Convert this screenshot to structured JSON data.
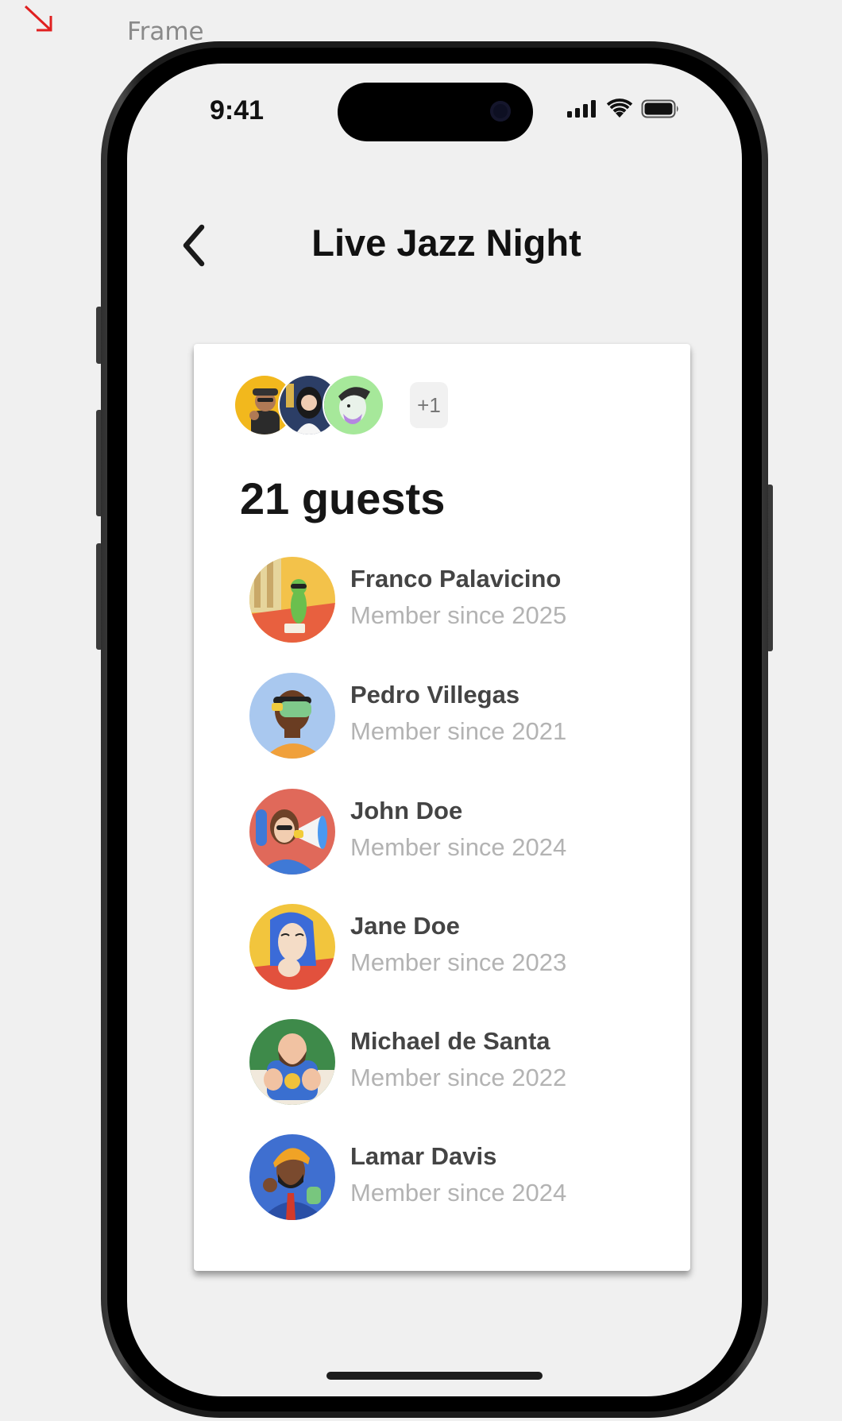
{
  "canvas": {
    "frame_label": "Frame"
  },
  "status_bar": {
    "time": "9:41"
  },
  "header": {
    "title": "Live Jazz Night"
  },
  "card": {
    "more_count": "+1",
    "guest_count": "21 guests",
    "stack_avatars": [
      {
        "icon": "man-with-cap-avatar"
      },
      {
        "icon": "woman-portrait-avatar"
      },
      {
        "icon": "green-character-avatar"
      }
    ],
    "guests": [
      {
        "name": "Franco Palavicino",
        "since": "Member since 2025",
        "icon": "worm-character-avatar"
      },
      {
        "name": "Pedro Villegas",
        "since": "Member since 2021",
        "icon": "vr-headset-man-avatar"
      },
      {
        "name": "John Doe",
        "since": "Member since 2024",
        "icon": "megaphone-woman-avatar"
      },
      {
        "name": "Jane Doe",
        "since": "Member since 2023",
        "icon": "blue-hair-woman-avatar"
      },
      {
        "name": "Michael de Santa",
        "since": "Member since 2022",
        "icon": "bearded-man-avatar"
      },
      {
        "name": "Lamar Davis",
        "since": "Member since 2024",
        "icon": "turban-man-avatar"
      }
    ]
  },
  "colors": {
    "background": "#f0f0f0",
    "card": "#ffffff",
    "name_text": "#444444",
    "secondary_text": "#b3b3b3"
  }
}
